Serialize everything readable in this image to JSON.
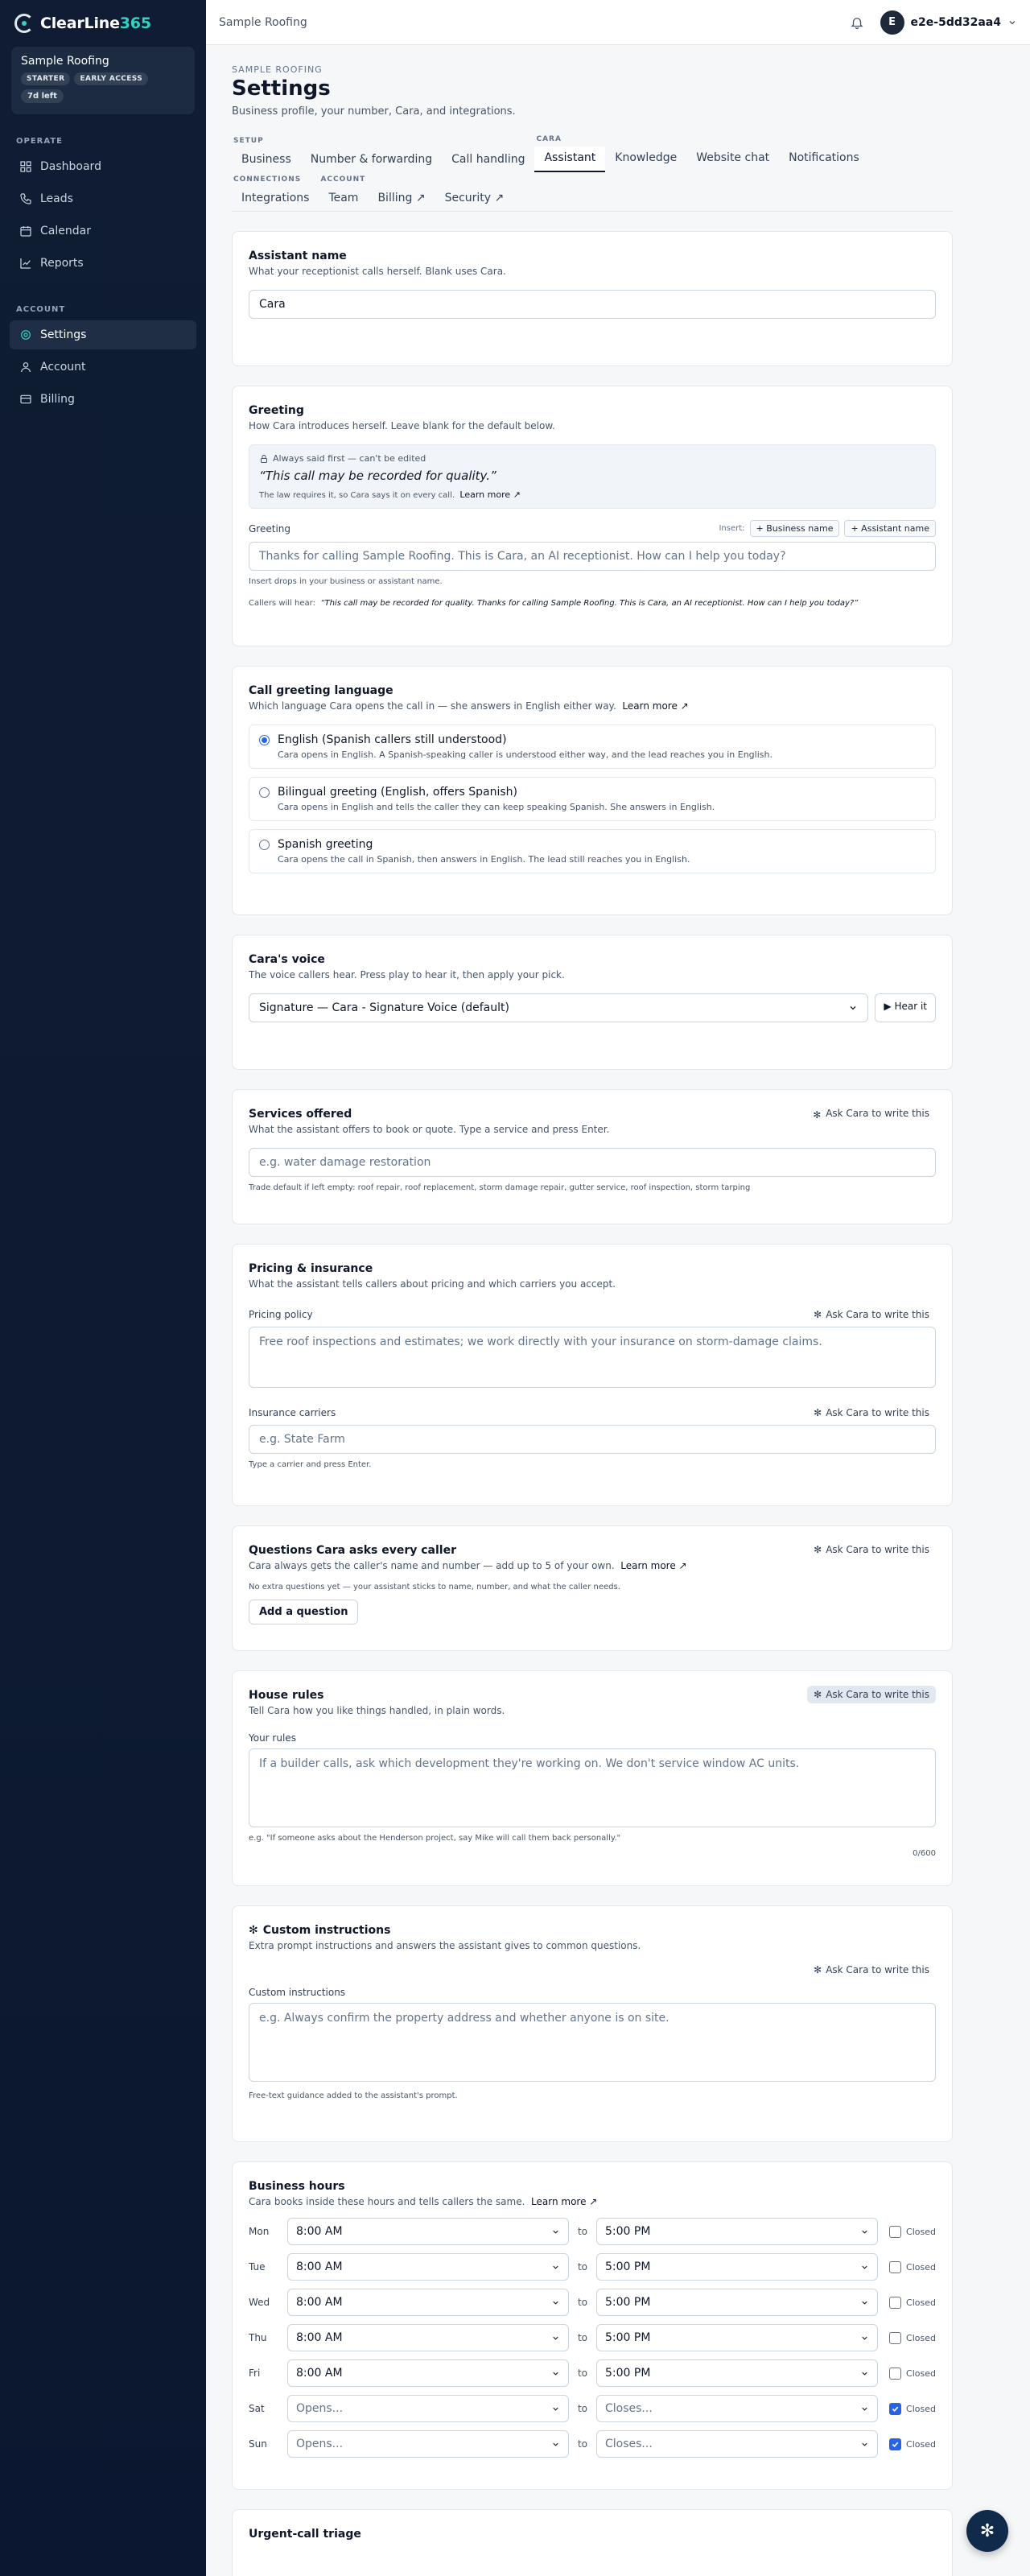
{
  "sidebar": {
    "logo": {
      "brand": "ClearLine",
      "num": "365"
    },
    "account": {
      "name": "Sample Roofing",
      "badges": [
        "STARTER",
        "EARLY ACCESS"
      ],
      "trial": "7d left"
    },
    "sections": [
      {
        "label": "OPERATE",
        "items": [
          {
            "label": "Dashboard",
            "icon": "dashboard-icon"
          },
          {
            "label": "Leads",
            "icon": "phone-icon"
          },
          {
            "label": "Calendar",
            "icon": "calendar-icon"
          },
          {
            "label": "Reports",
            "icon": "chart-icon"
          }
        ]
      },
      {
        "label": "ACCOUNT",
        "items": [
          {
            "label": "Settings",
            "icon": "gear-icon",
            "active": true
          },
          {
            "label": "Account",
            "icon": "user-icon"
          },
          {
            "label": "Billing",
            "icon": "card-icon"
          }
        ]
      }
    ]
  },
  "topbar": {
    "breadcrumb": "Sample Roofing",
    "avatar_initial": "E",
    "user": "e2e-5dd32aa4"
  },
  "header": {
    "eyebrow": "SAMPLE ROOFING",
    "title": "Settings",
    "subtitle": "Business profile, your number, Cara, and integrations."
  },
  "tabs": {
    "setup_label": "SETUP",
    "cara_label": "CARA",
    "connections_label": "CONNECTIONS",
    "account_label": "ACCOUNT",
    "business": "Business",
    "number": "Number & forwarding",
    "call_handling": "Call handling",
    "assistant": "Assistant",
    "knowledge": "Knowledge",
    "website_chat": "Website chat",
    "notifications": "Notifications",
    "integrations": "Integrations",
    "team": "Team",
    "billing": "Billing ↗",
    "security": "Security ↗"
  },
  "assistant_name": {
    "title": "Assistant name",
    "sub": "What your receptionist calls herself. Blank uses Cara.",
    "value": "Cara"
  },
  "greeting": {
    "title": "Greeting",
    "sub": "How Cara introduces herself. Leave blank for the default below.",
    "locked_label": "Always said first — can't be edited",
    "locked_quote": "“This call may be recorded for quality.”",
    "locked_note": "The law requires it, so Cara says it on every call.",
    "learn_more": "Learn more ↗",
    "field_label": "Greeting",
    "insert_label": "Insert:",
    "chip_business": "+ Business name",
    "chip_assistant": "+ Assistant name",
    "placeholder": "Thanks for calling Sample Roofing. This is Cara, an AI receptionist. How can I help you today?",
    "hint": "Insert drops in your business or assistant name.",
    "preview_label": "Callers will hear:",
    "preview": "“This call may be recorded for quality. Thanks for calling Sample Roofing. This is Cara, an AI receptionist. How can I help you today?”"
  },
  "language": {
    "title": "Call greeting language",
    "sub": "Which language Cara opens the call in — she answers in English either way.",
    "learn_more": "Learn more ↗",
    "options": [
      {
        "title": "English (Spanish callers still understood)",
        "desc": "Cara opens in English. A Spanish-speaking caller is understood either way, and the lead reaches you in English.",
        "selected": true
      },
      {
        "title": "Bilingual greeting (English, offers Spanish)",
        "desc": "Cara opens in English and tells the caller they can keep speaking Spanish. She answers in English.",
        "selected": false
      },
      {
        "title": "Spanish greeting",
        "desc": "Cara opens the call in Spanish, then answers in English. The lead still reaches you in English.",
        "selected": false
      }
    ]
  },
  "voice": {
    "title": "Cara's voice",
    "sub": "The voice callers hear. Press play to hear it, then apply your pick.",
    "selected": "Signature — Cara - Signature Voice (default)",
    "hear": "▶ Hear it"
  },
  "services": {
    "title": "Services offered",
    "sub": "What the assistant offers to book or quote. Type a service and press Enter.",
    "ask": "Ask Cara to write this",
    "placeholder": "e.g. water damage restoration",
    "hint": "Trade default if left empty: roof repair, roof replacement, storm damage repair, gutter service, roof inspection, storm tarping"
  },
  "pricing": {
    "title": "Pricing & insurance",
    "sub": "What the assistant tells callers about pricing and which carriers you accept.",
    "policy_label": "Pricing policy",
    "ask": "Ask Cara to write this",
    "policy_placeholder": "Free roof inspections and estimates; we work directly with your insurance on storm-damage claims.",
    "carriers_label": "Insurance carriers",
    "carriers_placeholder": "e.g. State Farm",
    "carriers_hint": "Type a carrier and press Enter."
  },
  "questions": {
    "title": "Questions Cara asks every caller",
    "sub": "Cara always gets the caller's name and number — add up to 5 of your own.",
    "learn_more": "Learn more ↗",
    "ask": "Ask Cara to write this",
    "empty": "No extra questions yet — your assistant sticks to name, number, and what the caller needs.",
    "add": "Add a question"
  },
  "house_rules": {
    "title": "House rules",
    "sub": "Tell Cara how you like things handled, in plain words.",
    "ask": "Ask Cara to write this",
    "label": "Your rules",
    "placeholder": "If a builder calls, ask which development they're working on. We don't service window AC units.",
    "hint": "e.g. \"If someone asks about the Henderson project, say Mike will call them back personally.\"",
    "counter": "0/600"
  },
  "custom": {
    "title": "Custom instructions",
    "sub": "Extra prompt instructions and answers the assistant gives to common questions.",
    "ask": "Ask Cara to write this",
    "label": "Custom instructions",
    "placeholder": "e.g. Always confirm the property address and whether anyone is on site.",
    "hint": "Free-text guidance added to the assistant's prompt."
  },
  "hours": {
    "title": "Business hours",
    "sub": "Cara books inside these hours and tells callers the same.",
    "learn_more": "Learn more ↗",
    "to": "to",
    "closed": "Closed",
    "days": [
      {
        "day": "Mon",
        "open": "8:00 AM",
        "close": "5:00 PM",
        "closed": false,
        "placeholder": false
      },
      {
        "day": "Tue",
        "open": "8:00 AM",
        "close": "5:00 PM",
        "closed": false,
        "placeholder": false
      },
      {
        "day": "Wed",
        "open": "8:00 AM",
        "close": "5:00 PM",
        "closed": false,
        "placeholder": false
      },
      {
        "day": "Thu",
        "open": "8:00 AM",
        "close": "5:00 PM",
        "closed": false,
        "placeholder": false
      },
      {
        "day": "Fri",
        "open": "8:00 AM",
        "close": "5:00 PM",
        "closed": false,
        "placeholder": false
      },
      {
        "day": "Sat",
        "open": "Opens...",
        "close": "Closes...",
        "closed": true,
        "placeholder": true
      },
      {
        "day": "Sun",
        "open": "Opens...",
        "close": "Closes...",
        "closed": true,
        "placeholder": true
      }
    ]
  },
  "triage": {
    "title": "Urgent-call triage"
  },
  "colors": {
    "accent": "#2dd4bf",
    "sidebar": "#0f1c33",
    "check": "#2563eb"
  }
}
